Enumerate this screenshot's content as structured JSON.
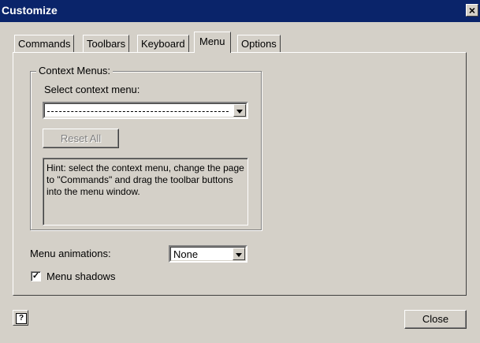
{
  "window": {
    "title": "Customize",
    "close_glyph": "×"
  },
  "tabs": [
    {
      "label": "Commands"
    },
    {
      "label": "Toolbars"
    },
    {
      "label": "Keyboard"
    },
    {
      "label": "Menu",
      "active": true
    },
    {
      "label": "Options"
    }
  ],
  "context_menus": {
    "group_label": "Context Menus:",
    "select_label": "Select context menu:",
    "select_value": "",
    "reset_all_label": "Reset All",
    "hint": "Hint: select the context menu, change the page to \"Commands\" and drag the toolbar buttons into the menu window."
  },
  "menu_animations": {
    "label": "Menu animations:",
    "value": "None"
  },
  "menu_shadows": {
    "label": "Menu shadows",
    "checked": true
  },
  "footer": {
    "help_glyph": "?",
    "close_label": "Close"
  },
  "icons": {
    "dialog_close": "close-icon",
    "dropdown": "chevron-down-icon",
    "help": "help-icon",
    "check": "check-icon"
  },
  "colors": {
    "titlebar": "#0a246a",
    "face": "#d4d0c8"
  }
}
